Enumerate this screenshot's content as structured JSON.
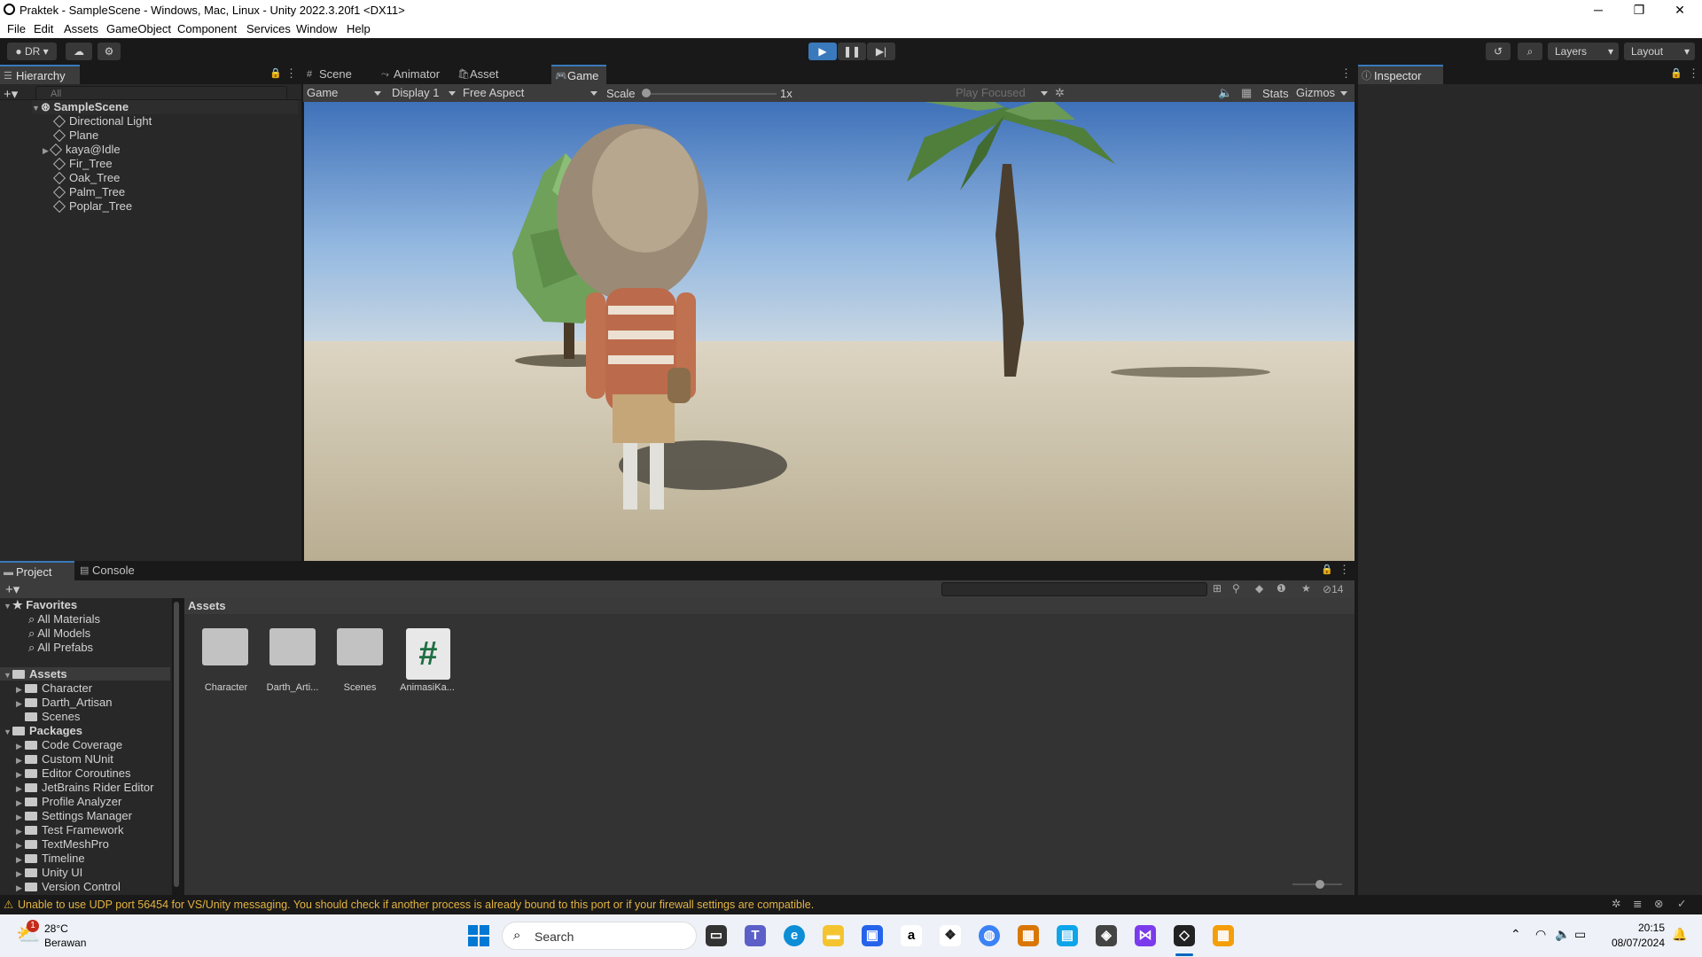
{
  "window": {
    "title": "Praktek - SampleScene - Windows, Mac, Linux - Unity 2022.3.20f1 <DX11>",
    "minimize": "─",
    "maximize": "❐",
    "close": "✕"
  },
  "menu": [
    "File",
    "Edit",
    "Assets",
    "GameObject",
    "Component",
    "Services",
    "Window",
    "Help"
  ],
  "toolbar": {
    "account": "DR",
    "layers": "Layers",
    "layout": "Layout"
  },
  "hierarchy": {
    "tab": "Hierarchy",
    "search_placeholder": "All",
    "scene": "SampleScene",
    "items": [
      "Directional Light",
      "Plane",
      "kaya@Idle",
      "Fir_Tree",
      "Oak_Tree",
      "Palm_Tree",
      "Poplar_Tree"
    ]
  },
  "center_tabs": [
    "Scene",
    "Animator",
    "Asset Store",
    "Game"
  ],
  "game_bar": {
    "mode": "Game",
    "display": "Display 1",
    "aspect": "Free Aspect",
    "scale_label": "Scale",
    "scale_value": "1x",
    "play_focused": "Play Focused",
    "stats": "Stats",
    "gizmos": "Gizmos"
  },
  "inspector": {
    "tab": "Inspector"
  },
  "bottom_tabs": [
    "Project",
    "Console"
  ],
  "project": {
    "favorites_label": "Favorites",
    "favorites": [
      "All Materials",
      "All Models",
      "All Prefabs"
    ],
    "assets_label": "Assets",
    "assets": [
      "Character",
      "Darth_Artisan",
      "Scenes"
    ],
    "packages_label": "Packages",
    "packages": [
      "Code Coverage",
      "Custom NUnit",
      "Editor Coroutines",
      "JetBrains Rider Editor",
      "Profile Analyzer",
      "Settings Manager",
      "Test Framework",
      "TextMeshPro",
      "Timeline",
      "Unity UI",
      "Version Control"
    ],
    "breadcrumb": "Assets",
    "hidden_count": "14",
    "grid": [
      {
        "label": "Character",
        "kind": "folder"
      },
      {
        "label": "Darth_Arti...",
        "kind": "folder"
      },
      {
        "label": "Scenes",
        "kind": "folder"
      },
      {
        "label": "AnimasiKa...",
        "kind": "script"
      }
    ]
  },
  "status": {
    "message": "Unable to use UDP port 56454 for VS/Unity messaging. You should check if another process is already bound to this port or if your firewall settings are compatible."
  },
  "taskbar": {
    "weather_temp": "28°C",
    "weather_desc": "Berawan",
    "weather_badge": "1",
    "search": "Search",
    "time": "20:15",
    "date": "08/07/2024"
  },
  "colors": {
    "accent": "#3a79bb",
    "panel": "#282828",
    "header": "#3c3c3c",
    "warning": "#e3b341"
  }
}
